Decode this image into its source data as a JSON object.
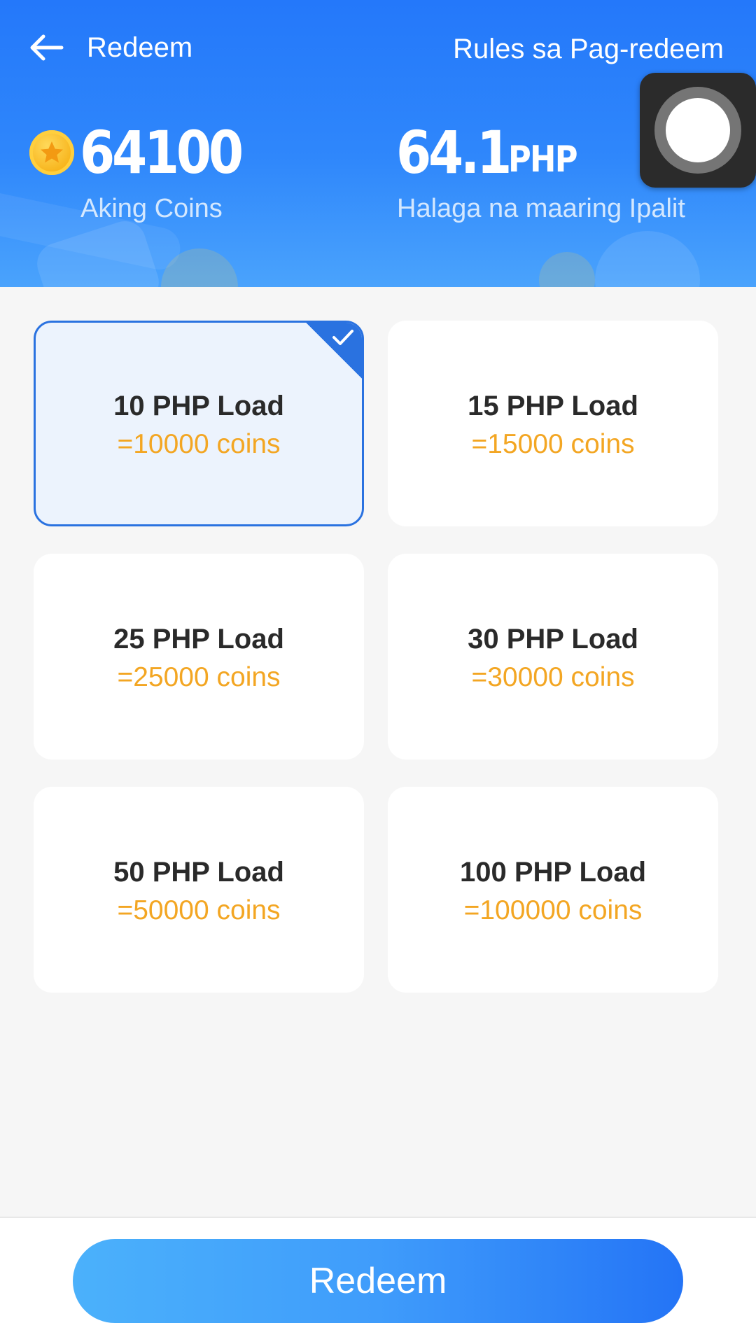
{
  "header": {
    "title": "Redeem",
    "rules_link": "Rules sa Pag-redeem",
    "coins": {
      "value": "64100",
      "caption": "Aking Coins",
      "icon": "star-coin-icon"
    },
    "redeemable": {
      "value": "64.1",
      "unit": "PHP",
      "caption": "Halaga na maaring Ipalit"
    }
  },
  "options": [
    {
      "label": "10 PHP Load",
      "cost": "=10000 coins",
      "selected": true
    },
    {
      "label": "15 PHP Load",
      "cost": "=15000 coins",
      "selected": false
    },
    {
      "label": "25 PHP Load",
      "cost": "=25000 coins",
      "selected": false
    },
    {
      "label": "30 PHP Load",
      "cost": "=30000 coins",
      "selected": false
    },
    {
      "label": "50 PHP Load",
      "cost": "=50000 coins",
      "selected": false
    },
    {
      "label": "100 PHP Load",
      "cost": "=100000 coins",
      "selected": false
    }
  ],
  "footer": {
    "redeem_button": "Redeem"
  },
  "colors": {
    "header_blue": "#2478fa",
    "accent_blue": "#2a72e0",
    "cost_orange": "#f3a623",
    "coin_gold": "#f7b31a"
  }
}
